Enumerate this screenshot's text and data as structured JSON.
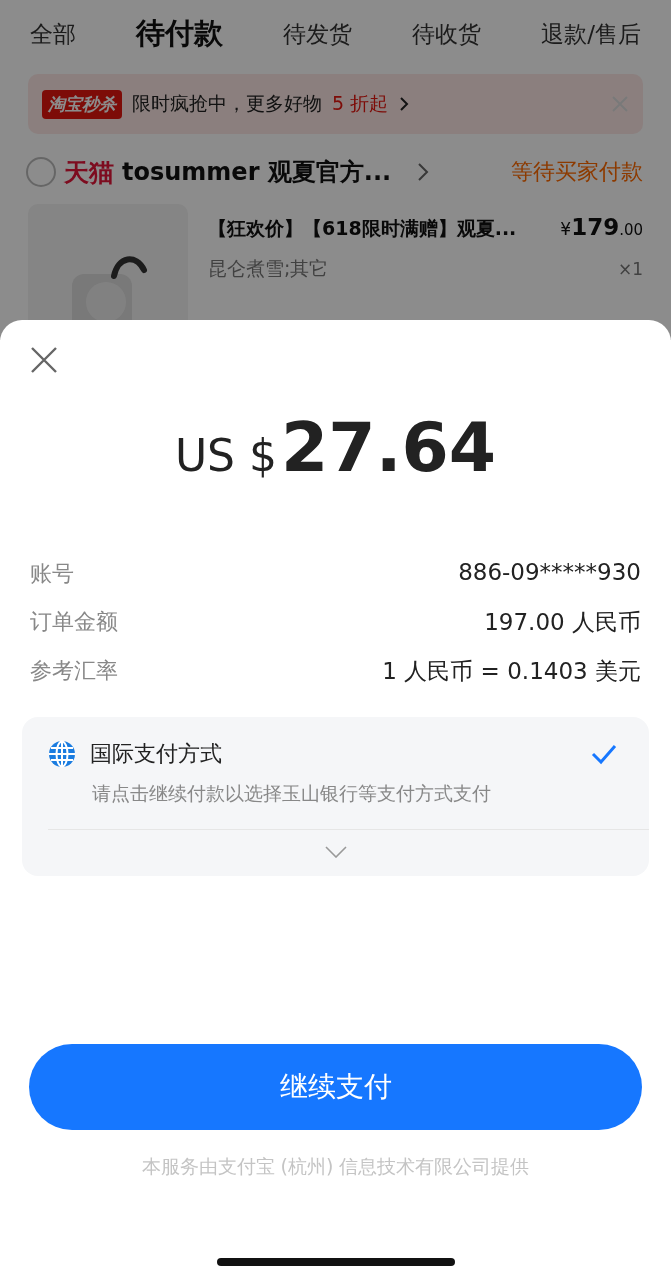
{
  "background_page": {
    "tabs": [
      {
        "label": "全部",
        "selected": false
      },
      {
        "label": "待付款",
        "selected": true
      },
      {
        "label": "待发货",
        "selected": false
      },
      {
        "label": "待收货",
        "selected": false
      },
      {
        "label": "退款/售后",
        "selected": false
      }
    ],
    "promo_banner": {
      "badge": "淘宝秒杀",
      "text": "限时疯抢中，更多好物",
      "highlight": "5 折起"
    },
    "store": {
      "checked": false,
      "brand": "天猫",
      "name": "tosummer 观夏官方...",
      "status": "等待买家付款"
    },
    "product": {
      "title": "【狂欢价】【618限时满赠】观夏...",
      "price_symbol": "¥",
      "price_integer": "179",
      "price_decimal": ".00",
      "variant": "昆仑煮雪;其它",
      "quantity": "×1"
    }
  },
  "payment_sheet": {
    "amount": {
      "currency": "US $",
      "value": "27.64"
    },
    "details": [
      {
        "label": "账号",
        "value": "886-09*****930"
      },
      {
        "label": "订单金额",
        "value": "197.00 人民币"
      },
      {
        "label": "参考汇率",
        "value": "1 人民币 = 0.1403 美元"
      }
    ],
    "payment_method": {
      "title": "国际支付方式",
      "subtitle": "请点击继续付款以选择玉山银行等支付方式支付",
      "selected": true,
      "expanded": false
    },
    "pay_button": "继续支付",
    "footer": "本服务由支付宝 (杭州) 信息技术有限公司提供"
  }
}
